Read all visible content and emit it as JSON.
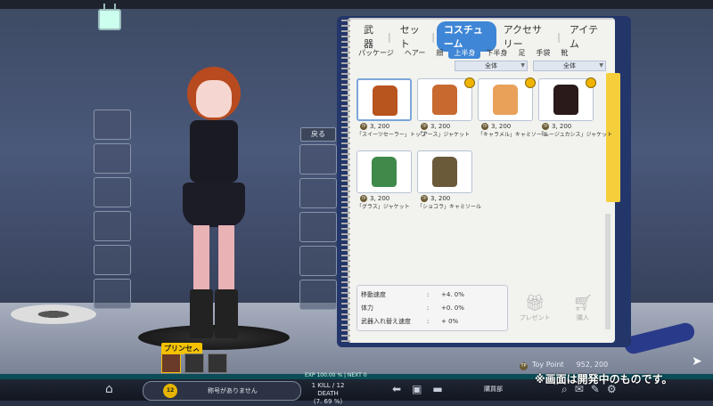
{
  "tabs": [
    "武器",
    "セット",
    "コスチューム",
    "アクセサリー",
    "アイテム"
  ],
  "active_tab": 2,
  "subtabs": [
    "パッケージ",
    "ヘアー",
    "顔",
    "上半身",
    "下半身",
    "足",
    "手袋",
    "靴"
  ],
  "active_subtab": 3,
  "filters": [
    "全体",
    "全体"
  ],
  "items": [
    {
      "price": "3, 200",
      "name": "「スイーツセーラー」トップ",
      "color": "#b8541e",
      "locked": false,
      "selected": true
    },
    {
      "price": "3, 200",
      "name": "「アース」ジャケット",
      "color": "#c86a30",
      "locked": true,
      "selected": false
    },
    {
      "price": "3, 200",
      "name": "「キャラメル」キャミソール",
      "color": "#e9a15a",
      "locked": true,
      "selected": false
    },
    {
      "price": "3, 200",
      "name": "「ルージュカシス」ジャケット",
      "color": "#2a1a1a",
      "locked": true,
      "selected": false
    },
    {
      "price": "3, 200",
      "name": "「グラス」ジャケット",
      "color": "#3f8a4a",
      "locked": false,
      "selected": false
    },
    {
      "price": "3, 200",
      "name": "「ショコラ」キャミソール",
      "color": "#6b5a3a",
      "locked": false,
      "selected": false
    }
  ],
  "tp_label": "TP",
  "stats": [
    {
      "label": "移動速度",
      "value": "+4. 0%"
    },
    {
      "label": "体力",
      "value": "+0. 0%"
    },
    {
      "label": "武器入れ替え速度",
      "value": "+ 0%"
    }
  ],
  "colon": ":",
  "actions": {
    "present": "プレゼント",
    "buy": "購入"
  },
  "back_label": "戻る",
  "toy_point": {
    "label": "Toy Point",
    "value": "952, 200"
  },
  "character": {
    "title": "プリンセス",
    "speaker": "◀"
  },
  "exp": {
    "label": "EXP",
    "text": "100.00 % | NEXT 0"
  },
  "nameplate": {
    "level": "12",
    "title": "称号がありません"
  },
  "kd": {
    "line1": "1 KILL / 12 DEATH",
    "line2": "(7. 69 %)"
  },
  "club": "購買部",
  "notice": "※画面は開発中のものです。"
}
